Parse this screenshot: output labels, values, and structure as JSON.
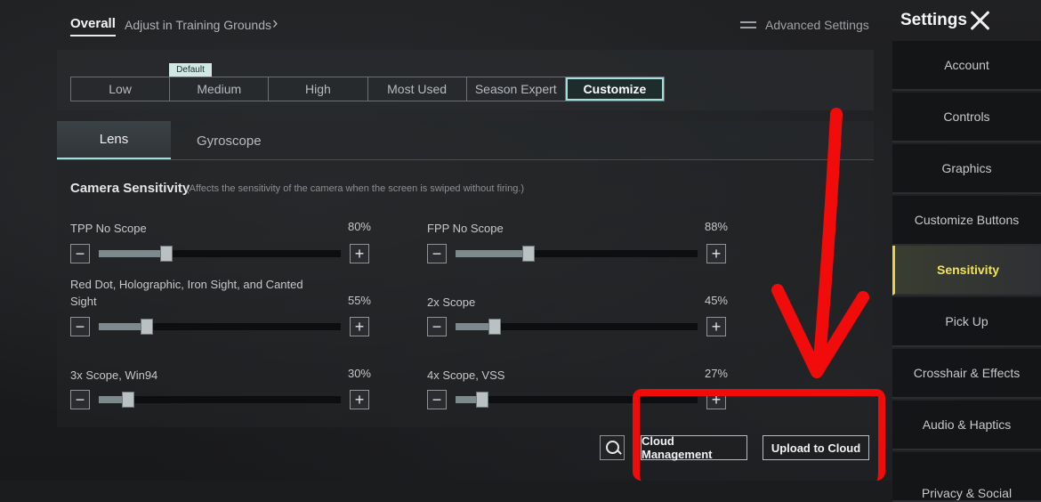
{
  "header": {
    "tab_overall": "Overall",
    "tab_adjust": "Adjust in Training Grounds",
    "advanced_settings": "Advanced Settings",
    "settings_title": "Settings"
  },
  "sidebar": {
    "items": [
      {
        "label": "Account"
      },
      {
        "label": "Controls"
      },
      {
        "label": "Graphics"
      },
      {
        "label": "Customize Buttons"
      },
      {
        "label": "Sensitivity",
        "active": true
      },
      {
        "label": "Pick Up"
      },
      {
        "label": "Crosshair & Effects"
      },
      {
        "label": "Audio & Haptics"
      },
      {
        "label": "Privacy & Social"
      }
    ]
  },
  "presets": {
    "default_badge": "Default",
    "items": [
      "Low",
      "Medium",
      "High",
      "Most Used",
      "Season Expert",
      "Customize"
    ],
    "selected": "Customize"
  },
  "subtabs": {
    "lens": "Lens",
    "gyroscope": "Gyroscope"
  },
  "camera": {
    "title": "Camera Sensitivity",
    "note": "(Affects the sensitivity of the camera when the screen is swiped without firing.)",
    "sliders": [
      {
        "label": "TPP No Scope",
        "value_text": "80%",
        "level": 0.28
      },
      {
        "label": "FPP No Scope",
        "value_text": "88%",
        "level": 0.3
      },
      {
        "label": "Red Dot, Holographic, Iron Sight, and Canted Sight",
        "value_text": "55%",
        "level": 0.2
      },
      {
        "label": "2x Scope",
        "value_text": "45%",
        "level": 0.16
      },
      {
        "label": "3x Scope, Win94",
        "value_text": "30%",
        "level": 0.12
      },
      {
        "label": "4x Scope, VSS",
        "value_text": "27%",
        "level": 0.11
      }
    ],
    "minus": "−",
    "plus": "+"
  },
  "actions": {
    "cloud_management": "Cloud Management",
    "upload_to_cloud": "Upload to Cloud"
  },
  "colors": {
    "accent": "#9fe0dc",
    "active_sidebar_text": "#f1e35a",
    "annotation_red": "#f20b0b"
  }
}
